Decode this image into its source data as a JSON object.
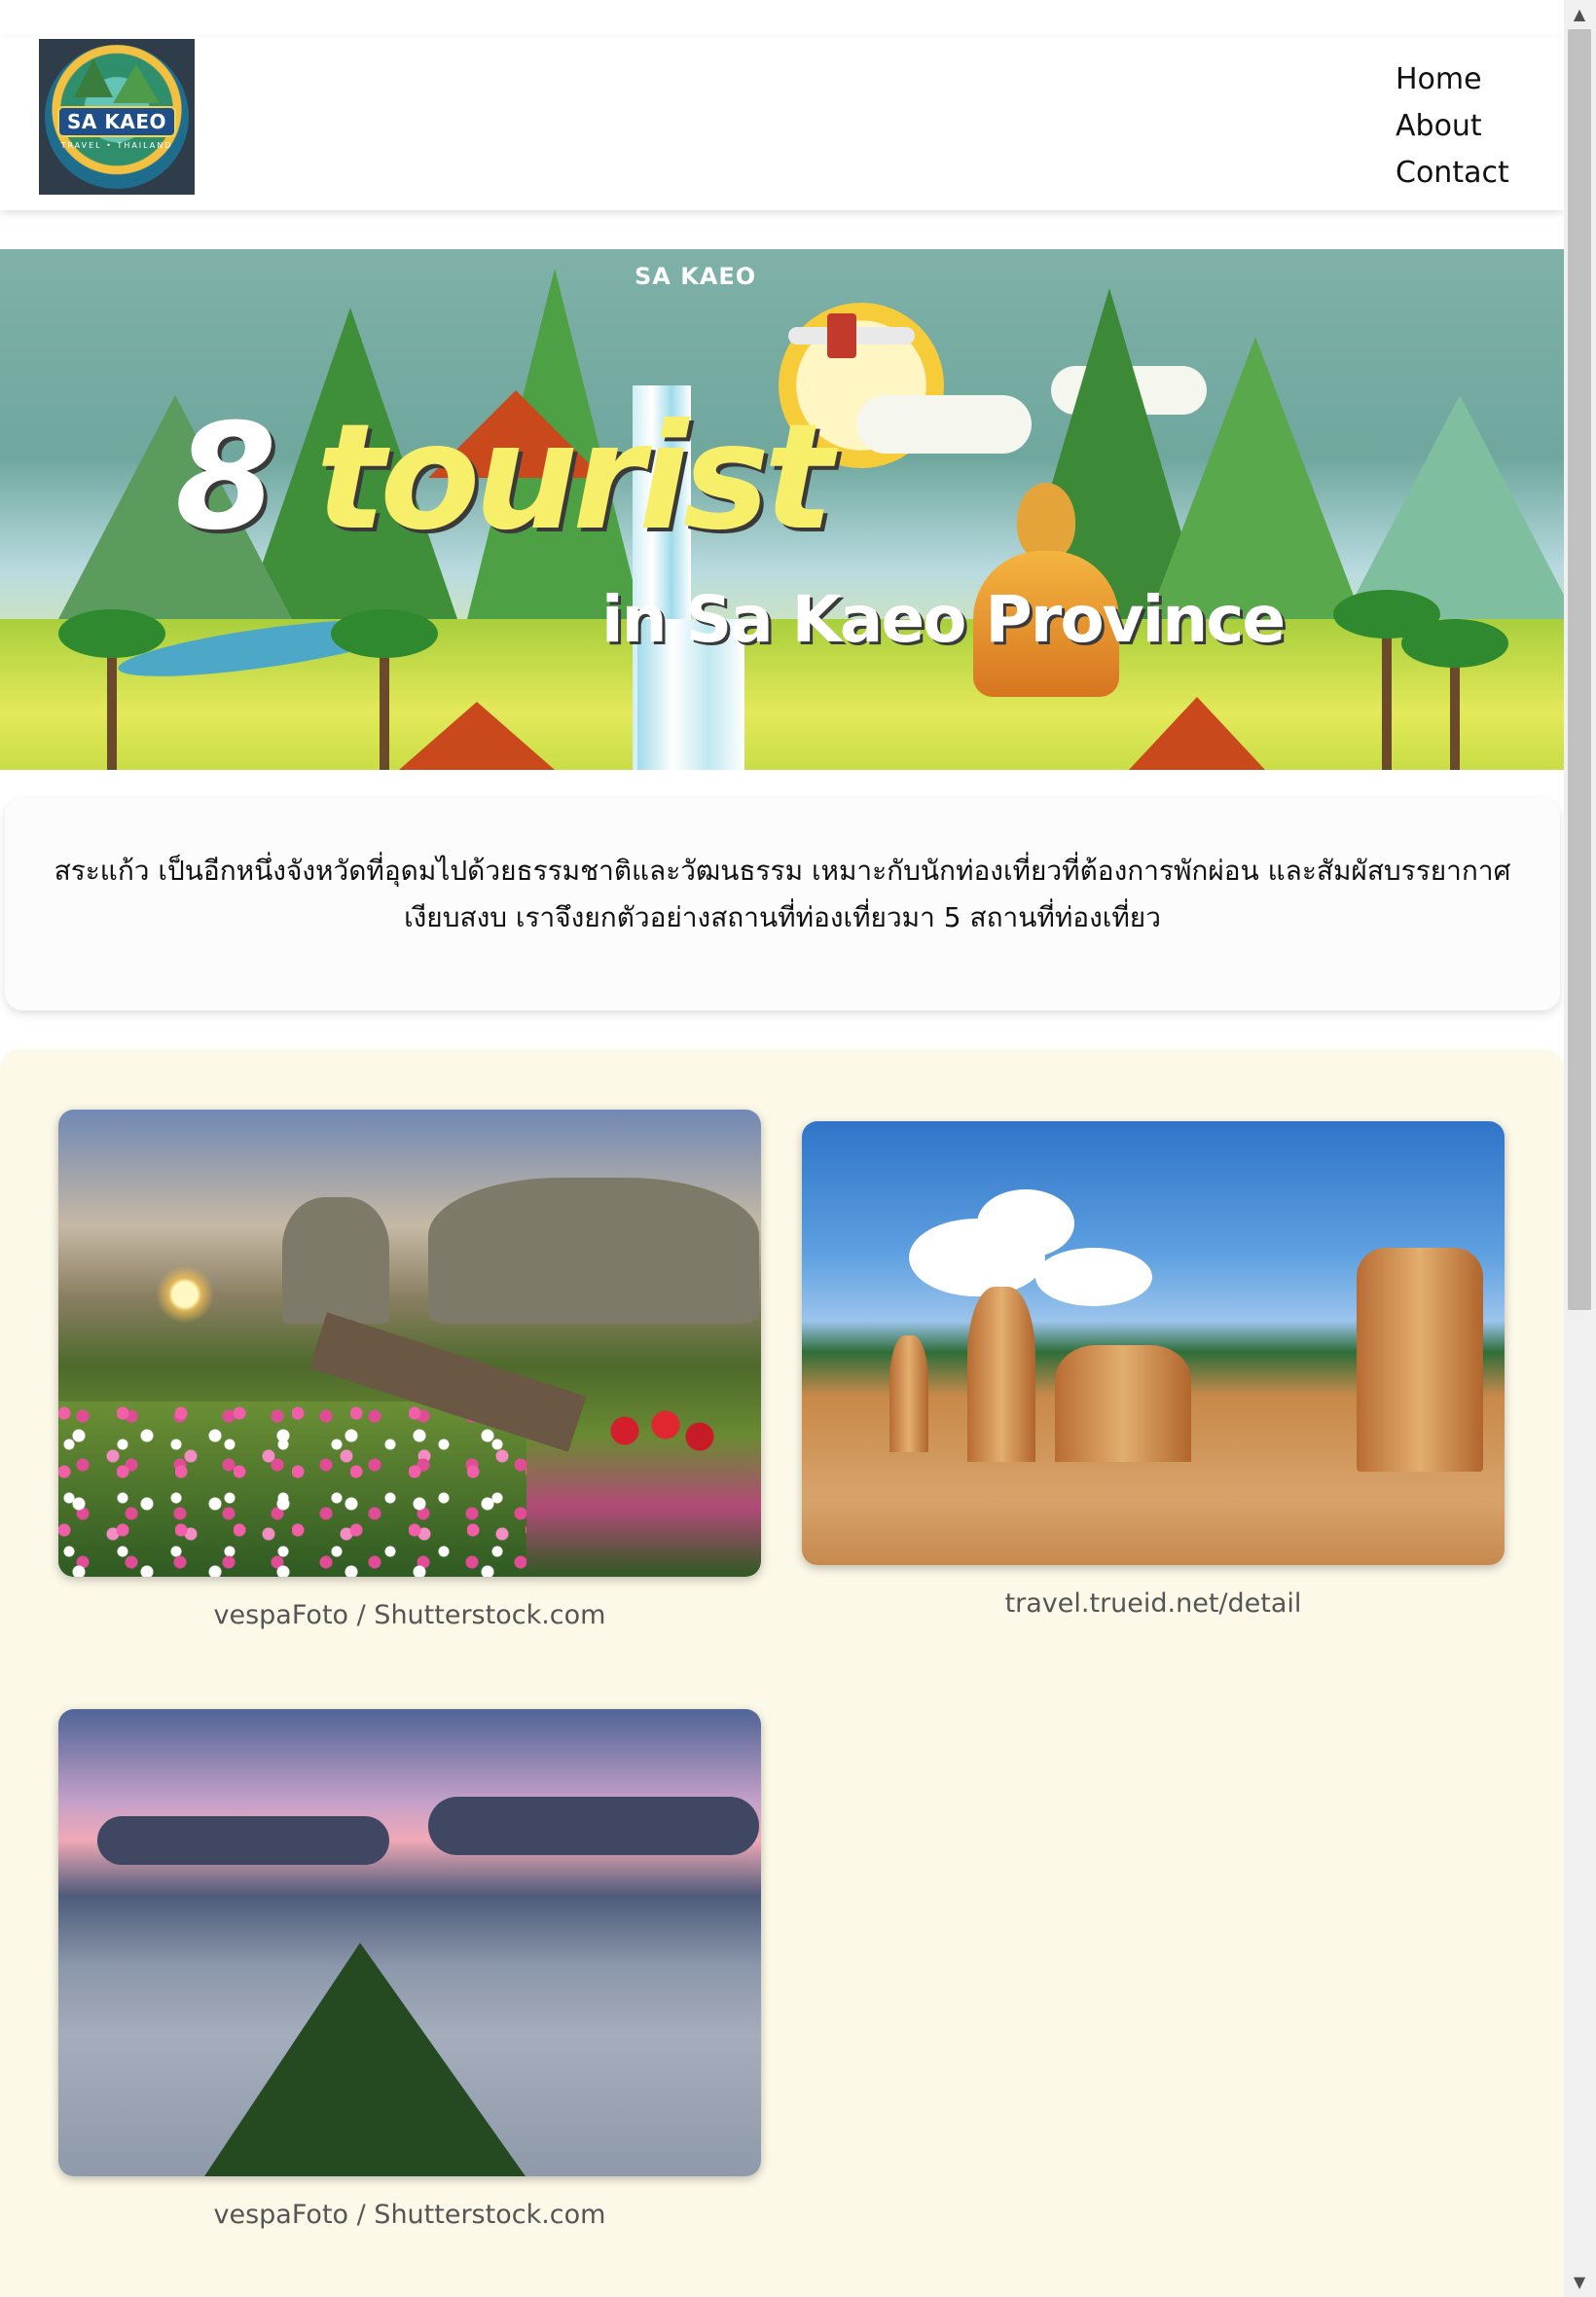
{
  "logo": {
    "top_text": "SA KAEO",
    "sub_text": "TRAVEL • THAILAND"
  },
  "nav": {
    "items": [
      "Home",
      "About",
      "Contact"
    ]
  },
  "hero": {
    "label": "SA KAEO",
    "number": "8",
    "word": "tourist",
    "subtitle": "in Sa Kaeo Province"
  },
  "intro": {
    "text": "สระแก้ว เป็นอีกหนึ่งจังหวัดที่อุดมไปด้วยธรรมชาติและวัฒนธรรม เหมาะกับนักท่องเที่ยวที่ต้องการพักผ่อน และสัมผัสบรรยากาศเงียบสงบ เราจึงยกตัวอย่างสถานที่ท่องเที่ยวมา 5 สถานที่ท่องเที่ยว"
  },
  "gallery": {
    "items": [
      {
        "caption": "vespaFoto / Shutterstock.com"
      },
      {
        "caption": "travel.trueid.net/detail"
      },
      {
        "caption": "vespaFoto / Shutterstock.com"
      }
    ]
  },
  "colors": {
    "gallery_bg": "#fdf9e8",
    "title_yellow": "#f7ee6a",
    "caption_gray": "#555555"
  }
}
